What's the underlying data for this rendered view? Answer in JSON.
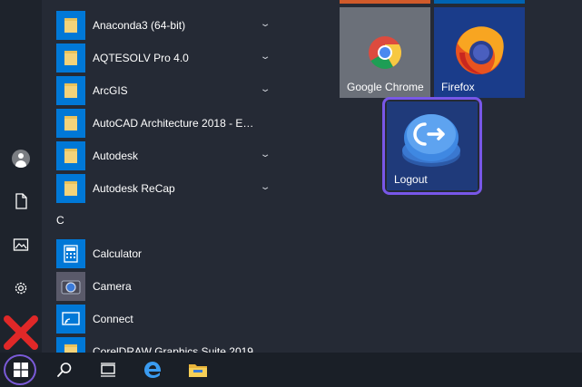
{
  "apps": [
    {
      "label": "Anaconda3 (64-bit)",
      "icon": "folder-icon",
      "expandable": true
    },
    {
      "label": "AQTESOLV Pro 4.0",
      "icon": "folder-icon",
      "expandable": true
    },
    {
      "label": "ArcGIS",
      "icon": "folder-icon",
      "expandable": true
    },
    {
      "label": "AutoCAD Architecture 2018 - En...",
      "icon": "folder-icon",
      "expandable": true
    },
    {
      "label": "Autodesk",
      "icon": "folder-icon",
      "expandable": true
    },
    {
      "label": "Autodesk ReCap",
      "icon": "folder-icon",
      "expandable": true
    },
    {
      "label": "Calculator",
      "icon": "calculator-icon",
      "expandable": false
    },
    {
      "label": "Camera",
      "icon": "camera-icon",
      "expandable": false
    },
    {
      "label": "Connect",
      "icon": "connect-icon",
      "expandable": false
    },
    {
      "label": "CorelDRAW Graphics Suite 2019",
      "icon": "folder-icon",
      "expandable": true
    }
  ],
  "section_header": "C",
  "tiles": {
    "chrome": "Google Chrome",
    "firefox": "Firefox",
    "logout": "Logout"
  },
  "colors": {
    "accent_blue": "#0078d7",
    "folder_yellow": "#f3d37a",
    "highlight_purple": "#7857e8",
    "error_red": "#e02828"
  }
}
